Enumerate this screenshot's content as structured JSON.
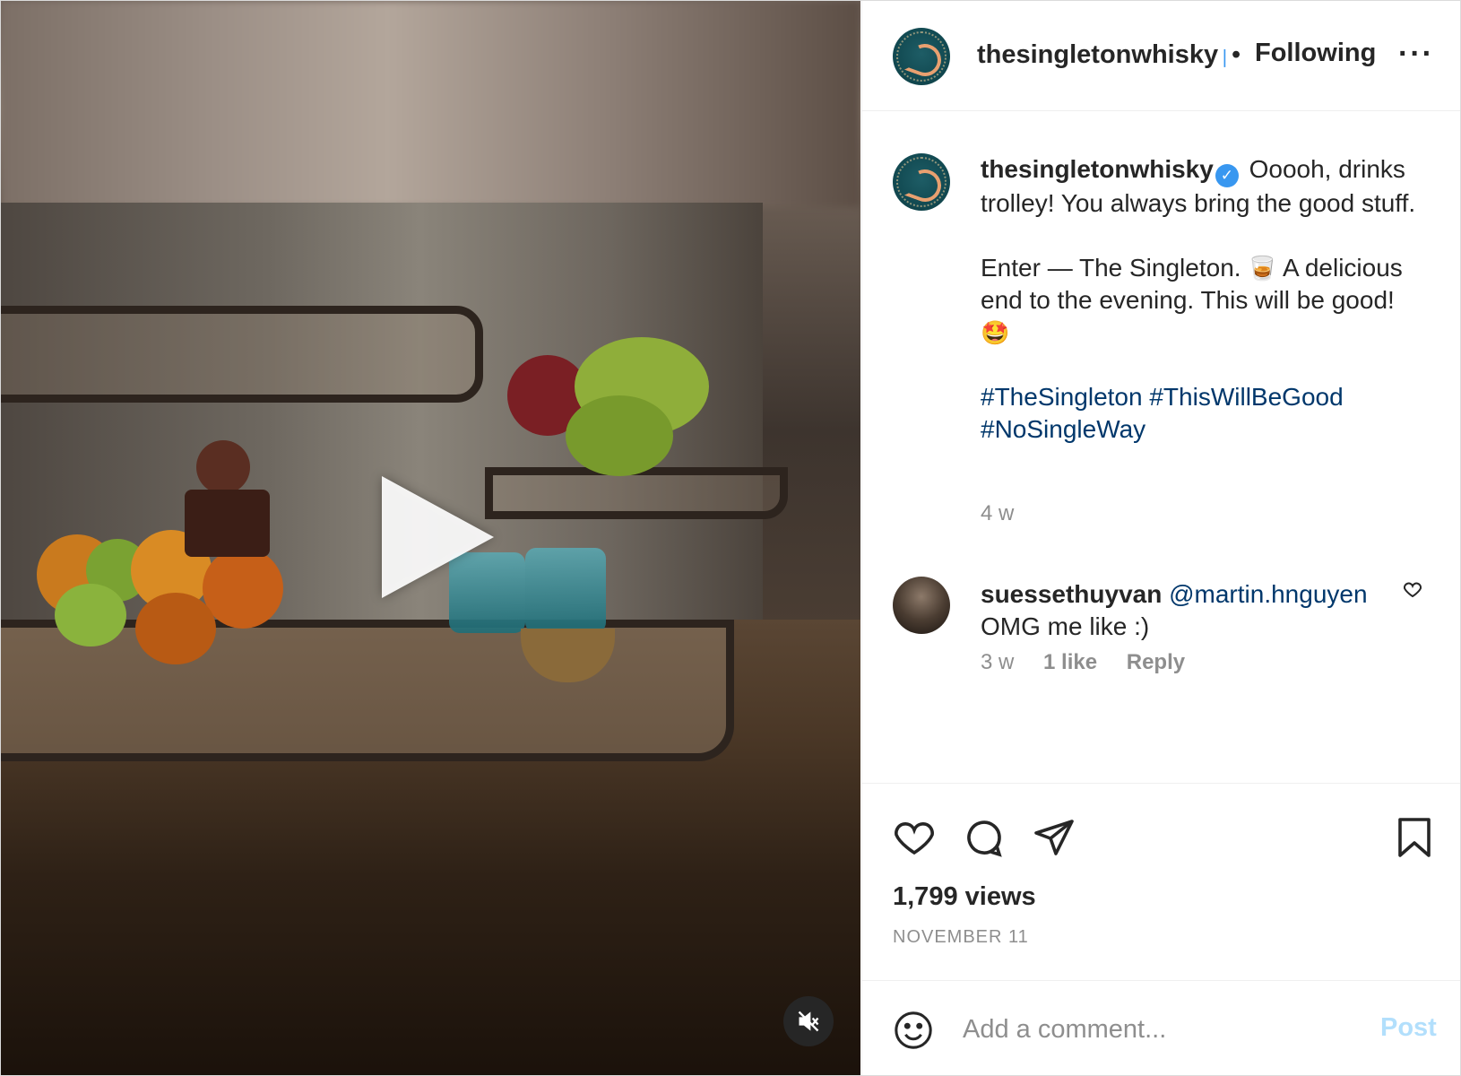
{
  "post": {
    "account": {
      "username": "thesingletonwhisky",
      "follow_status": "Following",
      "separator": "•",
      "more_icon": "more-horizontal-icon"
    },
    "caption": {
      "username": "thesingletonwhisky",
      "line1": "Ooooh, drinks trolley! You always bring the good stuff.",
      "line2_part1": "Enter — The Singleton.",
      "line2_emoji": "🥃",
      "line2_part2": "A delicious end to the evening. This will be good!",
      "line2_emoji2": "🤩",
      "hashtags": [
        "#TheSingleton",
        "#ThisWillBeGood",
        "#NoSingleWay"
      ],
      "age": "4 w"
    },
    "comments": [
      {
        "username": "suessethuyvan",
        "mention": "@martin.hnguyen",
        "text": "OMG me like :)",
        "age": "3 w",
        "likes": "1 like",
        "reply_label": "Reply"
      }
    ],
    "stats": {
      "views": "1,799 views",
      "date": "NOVEMBER 11"
    },
    "add_comment": {
      "placeholder": "Add a comment...",
      "post_label": "Post"
    },
    "colors": {
      "link": "#00376b",
      "verified": "#3897f0",
      "post_disabled": "#b2dffc",
      "muted": "#8e8e8e"
    },
    "icons": [
      "play-icon",
      "volume-muted-icon",
      "heart-icon",
      "comment-icon",
      "share-icon",
      "bookmark-icon",
      "emoji-icon"
    ]
  }
}
